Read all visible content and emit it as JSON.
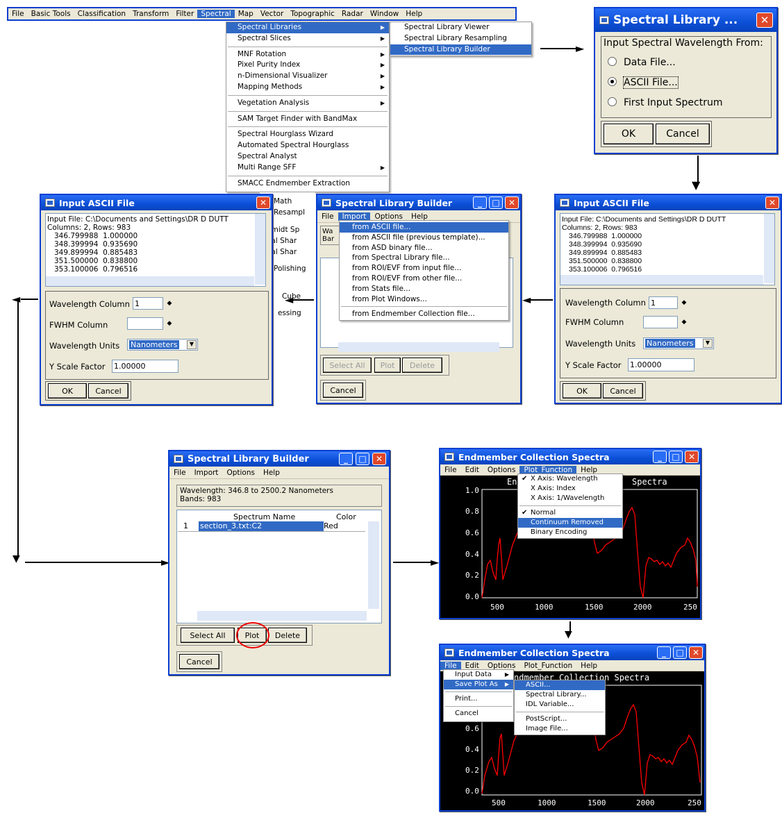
{
  "main_menu": {
    "items": [
      "File",
      "Basic Tools",
      "Classification",
      "Transform",
      "Filter",
      "Spectral",
      "Map",
      "Vector",
      "Topographic",
      "Radar",
      "Window",
      "Help"
    ],
    "selected": "Spectral"
  },
  "spectral_menu": {
    "items": [
      "Spectral Libraries",
      "Spectral Slices",
      "MNF Rotation",
      "Pixel Purity Index",
      "n-Dimensional Visualizer",
      "Mapping Methods",
      "Vegetation Analysis",
      "SAM Target Finder with BandMax",
      "Spectral Hourglass Wizard",
      "Automated Spectral Hourglass",
      "Spectral Analyst",
      "Multi Range SFF",
      "SMACC Endmember Extraction"
    ],
    "hidden_fragments": [
      "Math",
      "Resampl",
      "hmidt Sp",
      "tral Shar",
      "tral Shar",
      "Polishing",
      "Cube",
      "essing"
    ]
  },
  "libraries_submenu": {
    "items": [
      "Spectral Library Viewer",
      "Spectral Library Resampling",
      "Spectral Library Builder"
    ],
    "selected": "Spectral Library Builder"
  },
  "wavelength_dialog": {
    "title": "Spectral Library ...",
    "prompt": "Input Spectral Wavelength From:",
    "options": [
      "Data File...",
      "ASCII File...",
      "First Input Spectrum"
    ],
    "selected": "ASCII File...",
    "ok": "OK",
    "cancel": "Cancel"
  },
  "ascii_dialog": {
    "title": "Input ASCII File",
    "file_line": "Input File: C:\\Documents and Settings\\DR D DUTT",
    "cols_line": "Columns: 2, Rows: 983",
    "rows": [
      "346.799988  1.000000",
      "348.399994  0.935690",
      "349.899994  0.885483",
      "351.500000  0.838800",
      "353.100006  0.796516"
    ],
    "wl_col_label": "Wavelength Column",
    "wl_col_value": "1",
    "fwhm_label": "FWHM Column",
    "fwhm_value": "",
    "units_label": "Wavelength Units",
    "units_value": "Nanometers",
    "yscale_label": "Y Scale Factor",
    "yscale_value": "1.00000",
    "ok": "OK",
    "cancel": "Cancel"
  },
  "builder_import": {
    "title": "Spectral Library Builder",
    "menu": [
      "File",
      "Import",
      "Options",
      "Help"
    ],
    "menu_selected": "Import",
    "import_items": [
      "from ASCII file...",
      "from ASCII file (previous template)...",
      "from ASD binary file...",
      "from Spectral Library file...",
      "from ROI/EVF from input file...",
      "from ROI/EVF from other file...",
      "from Stats file...",
      "from Plot Windows...",
      "from Endmember Collection file..."
    ],
    "import_selected": "from ASCII file...",
    "frag_1": "Wa",
    "frag_2": "Bar",
    "select_all": "Select All",
    "plot": "Plot",
    "delete": "Delete",
    "cancel": "Cancel"
  },
  "builder_main": {
    "title": "Spectral Library Builder",
    "menu": [
      "File",
      "Import",
      "Options",
      "Help"
    ],
    "info_line1": "Wavelength: 346.8 to 2500.2 Nanometers",
    "info_line2": "Bands: 983",
    "col_name": "Spectrum Name",
    "col_color": "Color",
    "row_index": "1",
    "row_name": "section_3.txt:C2",
    "row_color": "Red",
    "select_all": "Select All",
    "plot": "Plot",
    "delete": "Delete",
    "cancel": "Cancel"
  },
  "plot_window1": {
    "title": "Endmember Collection Spectra",
    "menu": [
      "File",
      "Edit",
      "Options",
      "Plot_Function",
      "Help"
    ],
    "menu_selected": "Plot_Function",
    "plot_title_left": "En",
    "plot_title_right": "Spectra",
    "dropdown": [
      "X Axis: Wavelength",
      "X Axis: Index",
      "X Axis: 1/Wavelength",
      "Normal",
      "Continuum Removed",
      "Binary Encoding"
    ],
    "checked": [
      "X Axis: Wavelength",
      "Normal"
    ],
    "dropdown_selected": "Continuum Removed",
    "yticks": [
      "1.0",
      "0.8",
      "0.6",
      "0.4",
      "0.2",
      "0.0"
    ],
    "xticks": [
      "500",
      "1000",
      "1500",
      "2000",
      "250"
    ]
  },
  "plot_window2": {
    "title": "Endmember Collection Spectra",
    "menu": [
      "File",
      "Edit",
      "Options",
      "Plot_Function",
      "Help"
    ],
    "menu_selected": "File",
    "plot_title": "ndmember Collection Spectra",
    "file_menu": [
      "Input Data",
      "Save Plot As",
      "Print...",
      "Cancel"
    ],
    "file_selected": "Save Plot As",
    "save_menu": [
      "ASCII...",
      "Spectral Library...",
      "IDL Variable...",
      "PostScript...",
      "Image File..."
    ],
    "save_selected": "ASCII...",
    "yticks": [
      "0.6",
      "0.4",
      "0.2",
      "0.0"
    ],
    "xticks": [
      "500",
      "1000",
      "1500",
      "2000",
      "250"
    ]
  },
  "colors": {
    "spectrum": "#ff0000",
    "selection": "#316ac5",
    "titlebar": "#0b4fd6"
  }
}
